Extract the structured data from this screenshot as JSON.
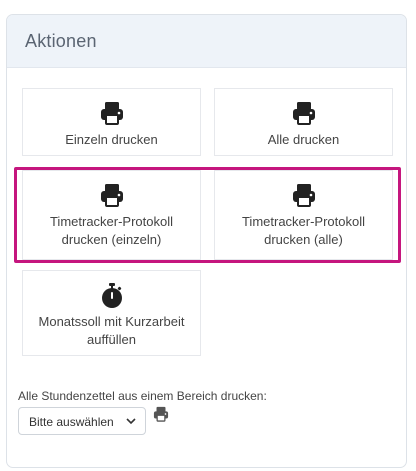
{
  "panel": {
    "title": "Aktionen"
  },
  "actions": {
    "print_single": "Einzeln drucken",
    "print_all": "Alle drucken",
    "timetracker_single_line1": "Timetracker-Protokoll",
    "timetracker_single_line2": "drucken (einzeln)",
    "timetracker_all_line1": "Timetracker-Protokoll",
    "timetracker_all_line2": "drucken (alle)",
    "monthly_line1": "Monatssoll mit Kurzarbeit",
    "monthly_line2": "auffüllen"
  },
  "area_print": {
    "label": "Alle Stundenzettel aus einem Bereich drucken:",
    "select_value": "Bitte auswählen"
  },
  "colors": {
    "highlight": "#c5167e",
    "header_bg": "#eef3f9",
    "icon": "#222222"
  },
  "icons": {
    "printer": "printer-icon",
    "stopwatch": "stopwatch-icon",
    "chevron": "chevron-down-icon"
  }
}
